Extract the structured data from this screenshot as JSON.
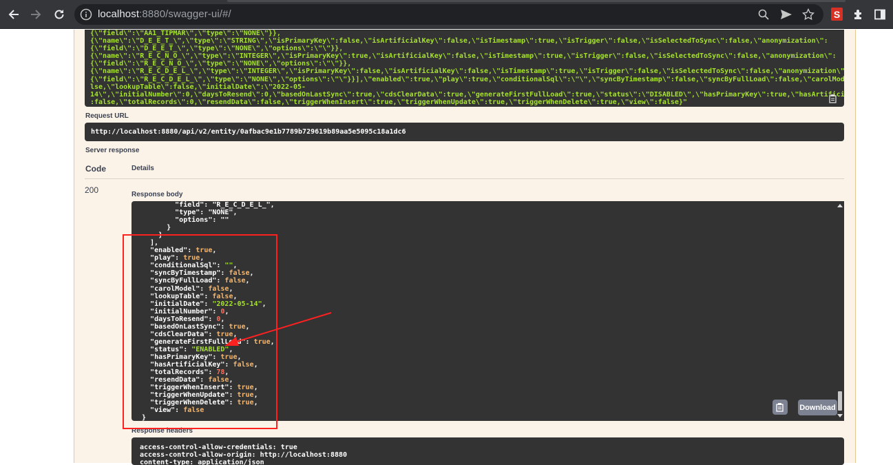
{
  "browser": {
    "url_host": "localhost",
    "url_rest": ":8880/swagger-ui/#/",
    "extension_letter": "S"
  },
  "curl_lines": [
    "{\\\"field\\\":\\\"AA1_TIPMAR\\\",\\\"type\\\":\\\"NONE\\\"}},",
    "{\\\"name\\\":\\\"D_E_E_T_\\\",\\\"type\\\":\\\"STRING\\\",\\\"isPrimaryKey\\\":false,\\\"isArtificialKey\\\":false,\\\"isTimestamp\\\":true,\\\"isTrigger\\\":false,\\\"isSelectedToSync\\\":false,\\\"anonymization\\\":",
    "{\\\"field\\\":\\\"D_E_E_T_\\\",\\\"type\\\":\\\"NONE\\\",\\\"options\\\":\\\"\\\"}},",
    "{\\\"name\\\":\\\"R_E_C_N_O_\\\",\\\"type\\\":\\\"INTEGER\\\",\\\"isPrimaryKey\\\":true,\\\"isArtificialKey\\\":false,\\\"isTimestamp\\\":true,\\\"isTrigger\\\":false,\\\"isSelectedToSync\\\":false,\\\"anonymization\\\":",
    "{\\\"field\\\":\\\"R_E_C_N_O_\\\",\\\"type\\\":\\\"NONE\\\",\\\"options\\\":\\\"\\\"}},",
    "{\\\"name\\\":\\\"R_E_C_D_E_L_\\\",\\\"type\\\":\\\"INTEGER\\\",\\\"isPrimaryKey\\\":false,\\\"isArtificialKey\\\":false,\\\"isTimestamp\\\":true,\\\"isTrigger\\\":false,\\\"isSelectedToSync\\\":false,\\\"anonymization\\\":",
    "{\\\"field\\\":\\\"R_E_C_D_E_L_\\\",\\\"type\\\":\\\"NONE\\\",\\\"options\\\":\\\"\\\"}}],\\\"enabled\\\":true,\\\"play\\\":true,\\\"conditionalSql\\\":\\\"\\\",\\\"syncByTimestamp\\\":false,\\\"syncByFullLoad\\\":false,\\\"carolModel\\\":fa",
    "lse,\\\"lookupTable\\\":false,\\\"initialDate\\\":\\\"2022-05-",
    "14\\\",\\\"initialNumber\\\":0,\\\"daysToResend\\\":0,\\\"basedOnLastSync\\\":true,\\\"cdsClearData\\\":true,\\\"generateFirstFullLoad\\\":true,\\\"status\\\":\\\"DISABLED\\\",\\\"hasPrimaryKey\\\":true,\\\"hasArtificialKey\\\"",
    ":false,\\\"totalRecords\\\":0,\\\"resendData\\\":false,\\\"triggerWhenInsert\\\":true,\\\"triggerWhenUpdate\\\":true,\\\"triggerWhenDelete\\\":true,\\\"view\\\":false}\""
  ],
  "request_url_label": "Request URL",
  "request_url": "http://localhost:8880/api/v2/entity/0afbac9e1b7789b729619b89aa5e5095c18a1dc6",
  "server_response_label": "Server response",
  "table": {
    "code_header": "Code",
    "details_header": "Details"
  },
  "status_code": "200",
  "response_body_label": "Response body",
  "response_body_head": [
    "        \"field\": \"R_E_C_D_E_L_\",",
    "        \"type\": \"NONE\",",
    "        \"options\": \"\"",
    "      }",
    "    }",
    "  ],"
  ],
  "response_fields": [
    {
      "key": "enabled",
      "value": "true",
      "kind": "b"
    },
    {
      "key": "play",
      "value": "true",
      "kind": "b"
    },
    {
      "key": "conditionalSql",
      "value": "\"\"",
      "kind": "s"
    },
    {
      "key": "syncByTimestamp",
      "value": "false",
      "kind": "b"
    },
    {
      "key": "syncByFullLoad",
      "value": "false",
      "kind": "b"
    },
    {
      "key": "carolModel",
      "value": "false",
      "kind": "b"
    },
    {
      "key": "lookupTable",
      "value": "false",
      "kind": "b"
    },
    {
      "key": "initialDate",
      "value": "\"2022-05-14\"",
      "kind": "s"
    },
    {
      "key": "initialNumber",
      "value": "0",
      "kind": "n"
    },
    {
      "key": "daysToResend",
      "value": "0",
      "kind": "n"
    },
    {
      "key": "basedOnLastSync",
      "value": "true",
      "kind": "b"
    },
    {
      "key": "cdsClearData",
      "value": "true",
      "kind": "b"
    },
    {
      "key": "generateFirstFullLoad",
      "value": "true",
      "kind": "b"
    },
    {
      "key": "status",
      "value": "\"ENABLED\"",
      "kind": "s"
    },
    {
      "key": "hasPrimaryKey",
      "value": "true",
      "kind": "b"
    },
    {
      "key": "hasArtificialKey",
      "value": "false",
      "kind": "b"
    },
    {
      "key": "totalRecords",
      "value": "78",
      "kind": "n"
    },
    {
      "key": "resendData",
      "value": "false",
      "kind": "b"
    },
    {
      "key": "triggerWhenInsert",
      "value": "true",
      "kind": "b"
    },
    {
      "key": "triggerWhenUpdate",
      "value": "true",
      "kind": "b"
    },
    {
      "key": "triggerWhenDelete",
      "value": "true",
      "kind": "b"
    },
    {
      "key": "view",
      "value": "false",
      "kind": "b",
      "last": true
    }
  ],
  "response_body_tail": "}",
  "download_label": "Download",
  "response_headers_label": "Response headers",
  "response_headers": [
    "access-control-allow-credentials: true",
    "access-control-allow-origin: http://localhost:8880",
    "content-type: application/json"
  ],
  "colors": {
    "annotation": "#ff2020",
    "json_string": "#a6e22e",
    "json_bool": "#f8b66b",
    "json_number": "#f96f5d"
  }
}
